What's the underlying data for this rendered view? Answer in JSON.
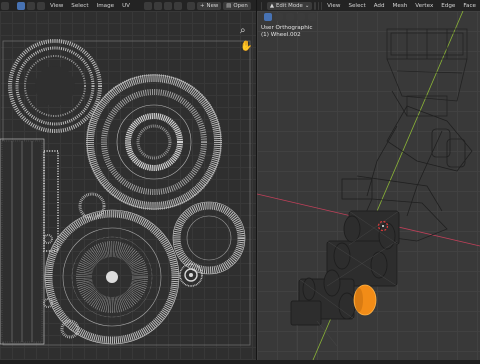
{
  "uv_editor": {
    "menu": [
      "View",
      "Select",
      "Image",
      "UV"
    ],
    "new_label": "New",
    "open_label": "Open"
  },
  "viewport": {
    "mode": "Edit Mode",
    "menu": [
      "View",
      "Select",
      "Add",
      "Mesh",
      "Vertex",
      "Edge",
      "Face"
    ],
    "view_name": "User Orthographic",
    "object_name": "(1) Wheel.002"
  },
  "icons": {
    "zoom": "zoom-icon",
    "pan": "hand-pan-icon"
  },
  "colors": {
    "selection": "#f28c17",
    "x_axis": "#c2405a",
    "y_axis": "#8bb437"
  }
}
